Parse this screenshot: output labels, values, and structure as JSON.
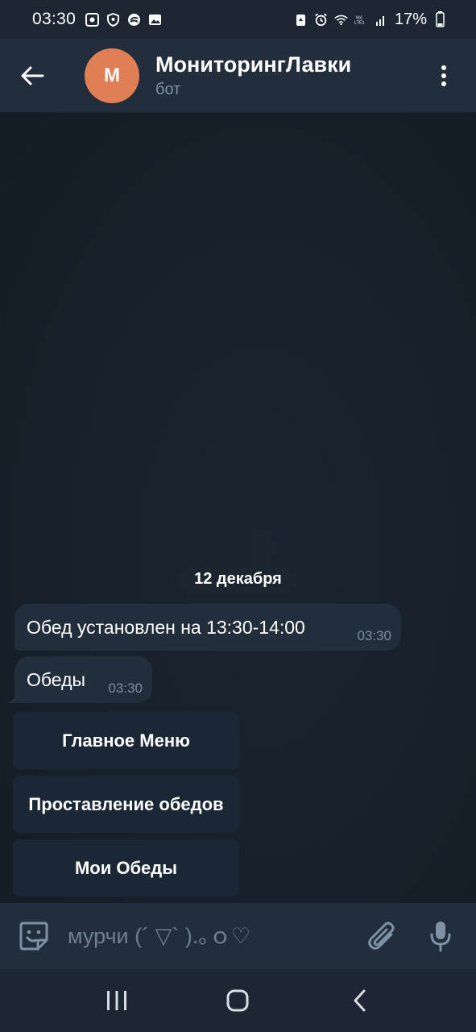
{
  "status_bar": {
    "time": "03:30",
    "battery": "17%",
    "left_icons": [
      "notification-icon",
      "shield-icon",
      "sync-icon",
      "gallery-icon"
    ],
    "right_icons": [
      "recycle-icon",
      "alarm-icon",
      "wifi-icon",
      "volte-icon",
      "signal-icon",
      "battery-icon"
    ]
  },
  "header": {
    "avatar_letter": "М",
    "avatar_color": "#e07f56",
    "title": "МониторингЛавки",
    "subtitle": "бот"
  },
  "chat": {
    "date_separator": "12 декабря",
    "messages": [
      {
        "text": "Обед установлен на 13:30-14:00",
        "time": "03:30"
      },
      {
        "text": "Обеды",
        "time": "03:30"
      }
    ],
    "keyboard_buttons": [
      {
        "label": "Главное Меню"
      },
      {
        "label": "Проставление обедов"
      },
      {
        "label": "Мои Обеды"
      }
    ]
  },
  "input": {
    "placeholder": "мурчи (´ ▽` ).｡ｏ♡"
  },
  "colors": {
    "background": "#17212b",
    "header": "#232e3c",
    "bubble": "#222e3b",
    "accent_avatar": "#e07f56",
    "muted_text": "#7f91a4"
  }
}
